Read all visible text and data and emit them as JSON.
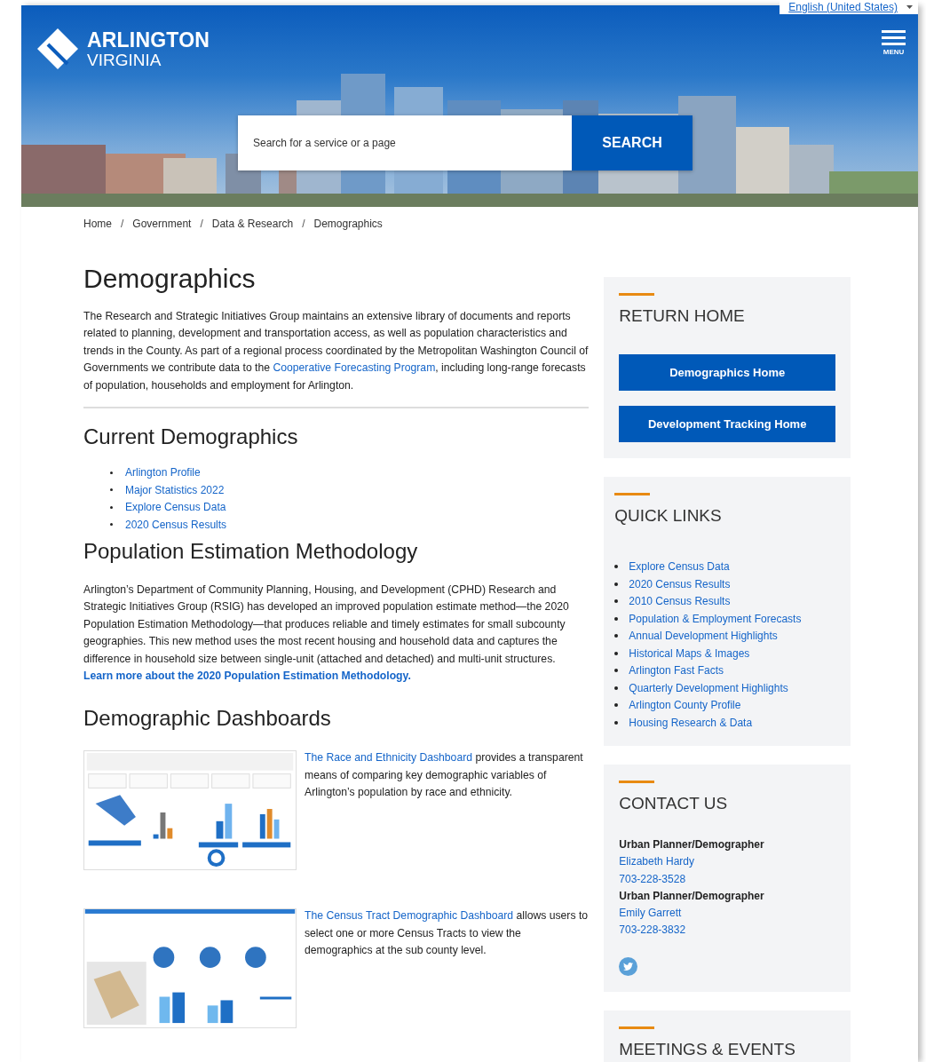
{
  "header": {
    "language": "English (United States)",
    "logo": {
      "line1": "ARLINGTON",
      "line2": "VIRGINIA"
    },
    "menu_label": "MENU",
    "search": {
      "placeholder": "Search for a service or a page",
      "button": "SEARCH"
    }
  },
  "breadcrumb": [
    "Home",
    "Government",
    "Data & Research",
    "Demographics"
  ],
  "breadcrumb_separator": "/",
  "title": "Demographics",
  "intro": [
    {
      "kind": "text",
      "text": "The Research and Strategic Initiatives Group maintains an extensive library of documents and reports related to planning, development and transportation access, as well as population characteristics and trends in the County. As part of a regional process coordinated by the Metropolitan Washington Council of Governments we contribute data to the "
    },
    {
      "kind": "link",
      "text": "Cooperative Forecasting Program"
    },
    {
      "kind": "text",
      "text": ", including long-range forecasts of population, households and employment for Arlington."
    }
  ],
  "current": {
    "heading": "Current Demographics",
    "links": [
      "Arlington Profile",
      "Major Statistics 2022",
      "Explore Census Data",
      "2020 Census Results"
    ]
  },
  "methodology": {
    "heading": "Population Estimation Methodology",
    "paragraph": [
      {
        "kind": "text",
        "text": "Arlington’s Department of Community Planning, Housing, and Development (CPHD) Research and Strategic Initiatives Group (RSIG) has developed an improved population estimate method—the 2020 Population Estimation Methodology—that produces reliable and timely estimates for small subcounty geographies. This new method uses the most recent housing and household data and captures the difference in household size between single-unit (attached and detached) and multi-unit structures. "
      },
      {
        "kind": "bold-link",
        "text": "Learn more about the 2020 Population Estimation Methodology."
      }
    ]
  },
  "dashboards": {
    "heading": "Demographic Dashboards",
    "items": [
      {
        "kind": "grid",
        "link": "The Race and Ethnicity Dashboard",
        "text": " provides a transparent means of comparing key demographic variables of Arlington’s population by race and ethnicity."
      },
      {
        "kind": "map",
        "link": "The Census Tract Demographic Dashboard",
        "text": " allows users to select one or more Census Tracts to view the demographics at the sub county level."
      }
    ]
  },
  "sidebar": [
    {
      "kind": "buttons",
      "heading": "RETURN HOME",
      "buttons": [
        "Demographics Home",
        "Development Tracking Home"
      ]
    },
    {
      "kind": "links",
      "heading": "QUICK LINKS",
      "links": [
        "Explore Census Data",
        "2020 Census Results",
        "2010 Census Results",
        "Population & Employment Forecasts",
        "Annual Development Highlights",
        "Historical Maps & Images",
        "Arlington Fast Facts",
        "Quarterly Development Highlights",
        "Arlington County Profile",
        "Housing Research & Data"
      ]
    },
    {
      "kind": "contacts",
      "heading": "CONTACT US",
      "contacts": [
        {
          "role": "Urban Planner/Demographer",
          "name": "Elizabeth Hardy",
          "phone": "703-228-3528"
        },
        {
          "role": "Urban Planner/Demographer",
          "name": "Emily Garrett",
          "phone": "703-228-3832"
        }
      ]
    },
    {
      "kind": "empty",
      "heading": "MEETINGS & EVENTS"
    }
  ]
}
